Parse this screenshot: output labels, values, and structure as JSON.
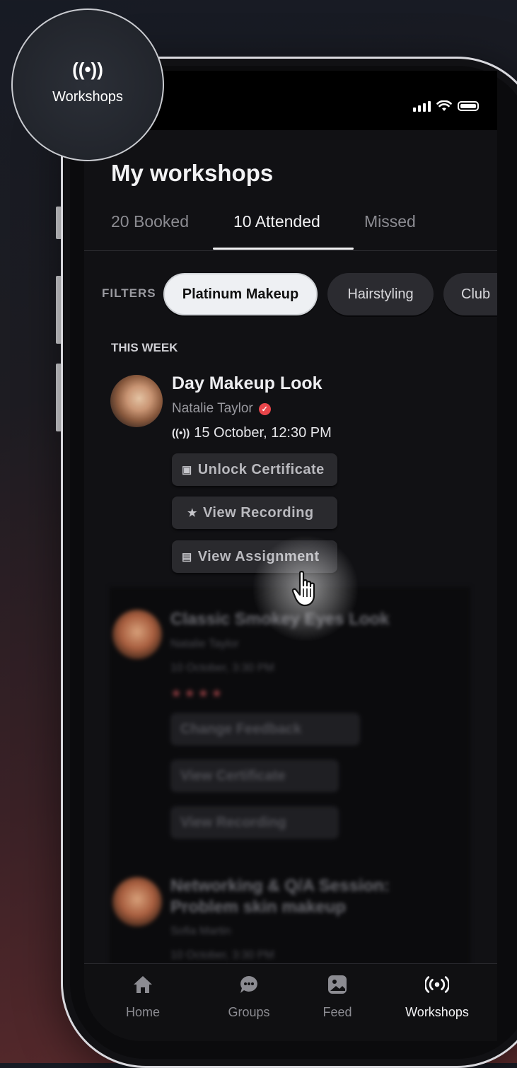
{
  "status_bar": {
    "signal_icon": "cellular-signal-icon",
    "wifi_icon": "wifi-icon",
    "battery_icon": "battery-icon"
  },
  "highlight": {
    "icon": "((•))",
    "label": "Workshops"
  },
  "header": {
    "title": "My workshops"
  },
  "tabs": [
    {
      "label": "20 Booked",
      "active": false
    },
    {
      "label": "10 Attended",
      "active": true
    },
    {
      "label": "Missed",
      "active": false
    }
  ],
  "filters": {
    "label": "FILTERS",
    "chips": [
      {
        "label": "Platinum Makeup",
        "active": true
      },
      {
        "label": "Hairstyling",
        "active": false
      },
      {
        "label": "Club",
        "active": false
      }
    ]
  },
  "section": {
    "label": "THIS WEEK"
  },
  "workshop": {
    "title": "Day Makeup Look",
    "host": "Natalie Taylor",
    "live_icon": "((•))",
    "datetime": "15 October, 12:30 PM",
    "actions": [
      {
        "label": "Unlock Certificate",
        "icon": "▣"
      },
      {
        "label": "View Recording",
        "icon": "★"
      },
      {
        "label": "View Assignment",
        "icon": "▤"
      }
    ]
  },
  "blurred_cards": [
    {
      "title": "Classic Smokey Eyes Look",
      "host": "Natalie Taylor",
      "datetime": "10 October, 3:30 PM",
      "rating": 4,
      "actions": [
        "Change Feedback",
        "View Certificate",
        "View Recording"
      ]
    },
    {
      "title": "Networking & Q/A Session: Problem skin makeup",
      "host": "Sofia Martin",
      "datetime": "10 October, 3:30 PM"
    }
  ],
  "bottom_nav": [
    {
      "label": "Home",
      "icon": "home-icon",
      "active": false
    },
    {
      "label": "Groups",
      "icon": "chat-bubble-icon",
      "active": false
    },
    {
      "label": "Feed",
      "icon": "image-icon",
      "active": false
    },
    {
      "label": "Workshops",
      "icon": "live-broadcast-icon",
      "active": true
    }
  ],
  "colors": {
    "accent": "#f2f2f4",
    "verified": "#e8454a",
    "background": "#111114"
  }
}
